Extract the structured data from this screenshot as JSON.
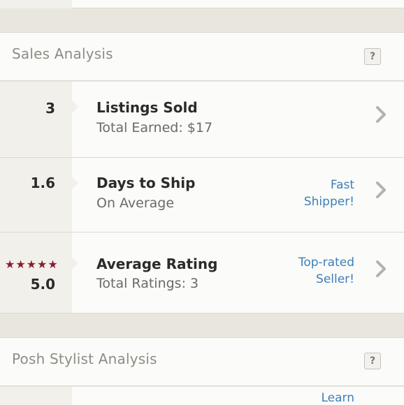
{
  "sales_section": {
    "title": "Sales Analysis",
    "help": "?"
  },
  "rows": [
    {
      "value": "3",
      "title": "Listings Sold",
      "subtitle": "Total Earned: $17",
      "badge_line1": "",
      "badge_line2": ""
    },
    {
      "value": "1.6",
      "title": "Days to Ship",
      "subtitle": "On Average",
      "badge_line1": "Fast",
      "badge_line2": "Shipper!"
    },
    {
      "value": "5.0",
      "stars": "★★★★★",
      "rating": 5,
      "title": "Average Rating",
      "subtitle": "Total Ratings: 3",
      "badge_line1": "Top-rated",
      "badge_line2": "Seller!"
    }
  ],
  "stylist_section": {
    "title": "Posh Stylist Analysis",
    "help": "?"
  },
  "stylist_row": {
    "badge_line1": "Learn"
  },
  "colors": {
    "accent_link": "#3d7fba",
    "star": "#8a1d2a"
  }
}
